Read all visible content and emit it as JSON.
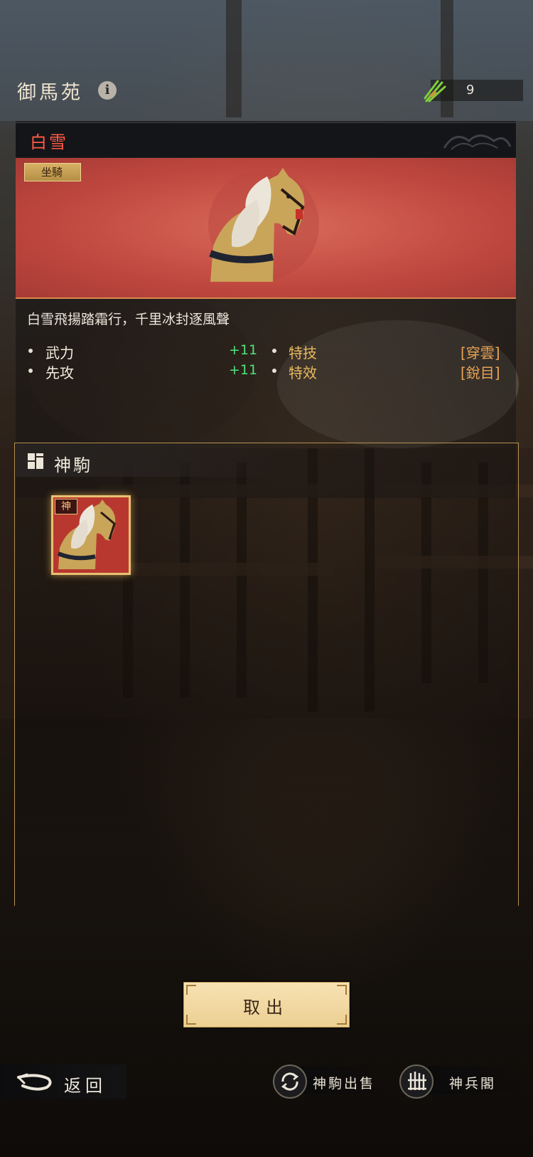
{
  "header": {
    "title": "御馬苑",
    "resource_value": "9"
  },
  "mount": {
    "name": "白雪",
    "type_badge": "坐騎",
    "description": "白雪飛揚踏霜行，千里冰封逐風聲",
    "stats": [
      {
        "label": "武力",
        "value": "+11"
      },
      {
        "label": "先攻",
        "value": "+11"
      }
    ],
    "skills": [
      {
        "label": "特技",
        "value": "[穿雲]"
      },
      {
        "label": "特效",
        "value": "[銳目]"
      }
    ]
  },
  "collection": {
    "title": "神駒",
    "items": [
      {
        "tag": "神"
      }
    ]
  },
  "actions": {
    "take_out": "取出",
    "back": "返回",
    "sell": "神駒出售",
    "armory": "神兵閣"
  },
  "colors": {
    "name": "#ff5a46",
    "stat_value": "#52e07a",
    "skill": "#e9b95d",
    "button": "#f2d9a0"
  },
  "icons": [
    "info-icon",
    "grass-bundle-icon",
    "collection-grid-icon",
    "back-arrow-icon",
    "cycle-arrows-icon",
    "weapon-rack-icon"
  ]
}
